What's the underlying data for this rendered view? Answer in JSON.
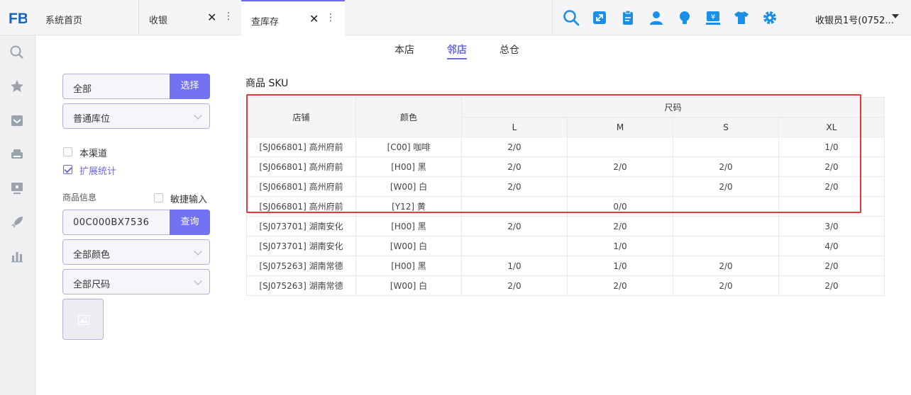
{
  "app": {
    "logo_text": "FB"
  },
  "tabs": [
    {
      "label": "系统首页"
    },
    {
      "label": "收银"
    },
    {
      "label": "查库存"
    }
  ],
  "tab_close_glyph": "✕",
  "tab_more_glyph": "⋮",
  "toolbar": {
    "icons": [
      "search-icon",
      "expand-icon",
      "clipboard-icon",
      "person-icon",
      "bulb-icon",
      "register-icon",
      "shirt-icon",
      "gear-icon"
    ],
    "user": "收银员1号(0752..."
  },
  "sidebar": {
    "icons": [
      "search-icon",
      "star-icon",
      "inbox-icon",
      "printer-icon",
      "monitor-icon",
      "rocket-icon",
      "bar-chart-icon"
    ]
  },
  "subtabs": [
    "本店",
    "邻店",
    "总仓"
  ],
  "filters": {
    "scope_value": "全部",
    "scope_button": "选择",
    "location_value": "普通库位",
    "channel_label": "本渠道",
    "channel_checked": false,
    "extend_label": "扩展统计",
    "extend_checked": true,
    "product_info_label": "商品信息",
    "quick_input_label": "敏捷输入",
    "quick_input_checked": false,
    "product_code": "00C000BX7536",
    "query_button": "查询",
    "color_value": "全部颜色",
    "size_value": "全部尺码"
  },
  "sku": {
    "title": "商品 SKU",
    "headers": {
      "store": "店铺",
      "color": "颜色",
      "size_group": "尺码",
      "sizes": [
        "L",
        "M",
        "S",
        "XL"
      ]
    },
    "rows": [
      {
        "store": "[SJ066801] 高州府前",
        "color": "[C00] 咖啡",
        "vals": [
          "2/0",
          "",
          "",
          "1/0"
        ]
      },
      {
        "store": "[SJ066801] 高州府前",
        "color": "[H00] 黑",
        "vals": [
          "2/0",
          "2/0",
          "2/0",
          "2/0"
        ]
      },
      {
        "store": "[SJ066801] 高州府前",
        "color": "[W00] 白",
        "vals": [
          "2/0",
          "",
          "2/0",
          "2/0"
        ]
      },
      {
        "store": "[SJ066801] 高州府前",
        "color": "[Y12] 黄",
        "vals": [
          "",
          "0/0",
          "",
          ""
        ]
      },
      {
        "store": "[SJ073701] 湖南安化",
        "color": "[H00] 黑",
        "vals": [
          "2/0",
          "2/0",
          "",
          "3/0"
        ]
      },
      {
        "store": "[SJ073701] 湖南安化",
        "color": "[W00] 白",
        "vals": [
          "",
          "1/0",
          "",
          "4/0"
        ]
      },
      {
        "store": "[SJ075263] 湖南常德",
        "color": "[H00] 黑",
        "vals": [
          "1/0",
          "1/0",
          "2/0",
          "2/0"
        ]
      },
      {
        "store": "[SJ075263] 湖南常德",
        "color": "[W00] 白",
        "vals": [
          "2/0",
          "2/0",
          "2/0",
          "2/0"
        ]
      }
    ]
  },
  "colors": {
    "accent": "#7272f2",
    "highlight_border": "#e53935",
    "tool_icon": "#1a8fe8"
  }
}
